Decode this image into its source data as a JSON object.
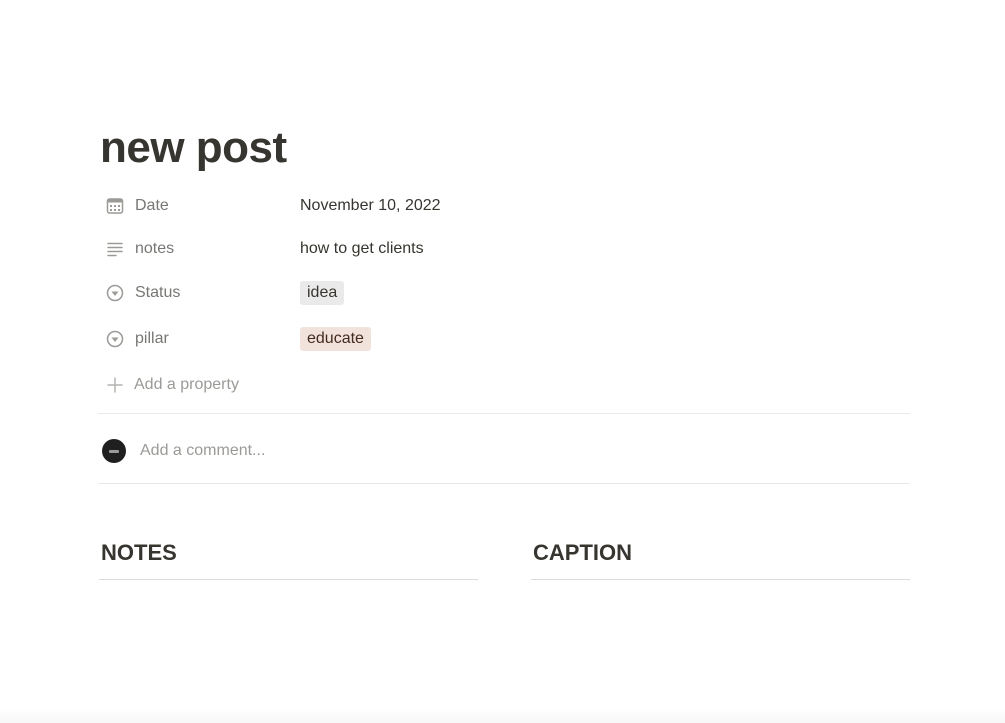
{
  "page": {
    "title": "new post"
  },
  "properties": [
    {
      "label": "Date",
      "icon": "calendar-icon",
      "value": "November 10, 2022"
    },
    {
      "label": "notes",
      "icon": "text-lines-icon",
      "value": "how to get clients"
    },
    {
      "label": "Status",
      "icon": "select-icon",
      "value": "idea",
      "tag_color": "#ebeaea"
    },
    {
      "label": "pillar",
      "icon": "select-icon",
      "value": "educate",
      "tag_color": "#f1e3dc"
    }
  ],
  "add_property": {
    "label": "Add a property",
    "icon": "plus-icon"
  },
  "comment": {
    "placeholder": "Add a comment..."
  },
  "sections": {
    "notes": "NOTES",
    "caption": "CAPTION"
  }
}
